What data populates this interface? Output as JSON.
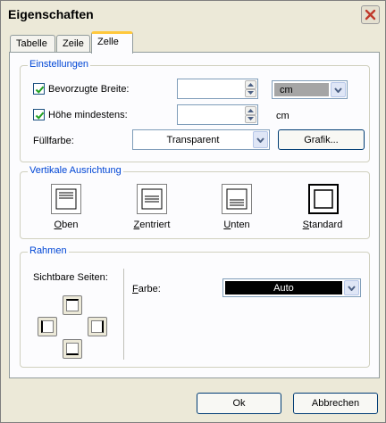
{
  "window": {
    "title": "Eigenschaften"
  },
  "tabs": [
    {
      "label": "Tabelle"
    },
    {
      "label": "Zeile"
    },
    {
      "label": "Zelle"
    }
  ],
  "settings": {
    "legend": "Einstellungen",
    "preferred_width": {
      "label": "Bevorzugte Breite:",
      "checked": true,
      "value": "",
      "unit": "cm"
    },
    "min_height": {
      "label": "Höhe mindestens:",
      "checked": true,
      "value": "",
      "unit": "cm"
    },
    "fill": {
      "label": "Füllfarbe:",
      "value": "Transparent",
      "button": "Grafik..."
    }
  },
  "vertical_alignment": {
    "legend": "Vertikale Ausrichtung",
    "options": [
      {
        "label": "Oben",
        "mnemonic": "O",
        "rest": "ben"
      },
      {
        "label": "Zentriert",
        "mnemonic": "Z",
        "rest": "entriert"
      },
      {
        "label": "Unten",
        "mnemonic": "U",
        "rest": "nten"
      },
      {
        "label": "Standard",
        "mnemonic": "S",
        "rest": "tandard"
      }
    ],
    "selected": "Standard"
  },
  "border": {
    "legend": "Rahmen",
    "visible_sides_label": "Sichtbare Seiten:",
    "color_label": {
      "mnemonic": "F",
      "rest": "arbe:"
    },
    "color_value": "Auto",
    "color_swatch": "#000000"
  },
  "footer": {
    "ok": "Ok",
    "cancel": "Abbrechen"
  },
  "colors": {
    "accent": "#0046d5",
    "close_x": "#c0392b",
    "tab_highlight": "#ffc83c"
  }
}
